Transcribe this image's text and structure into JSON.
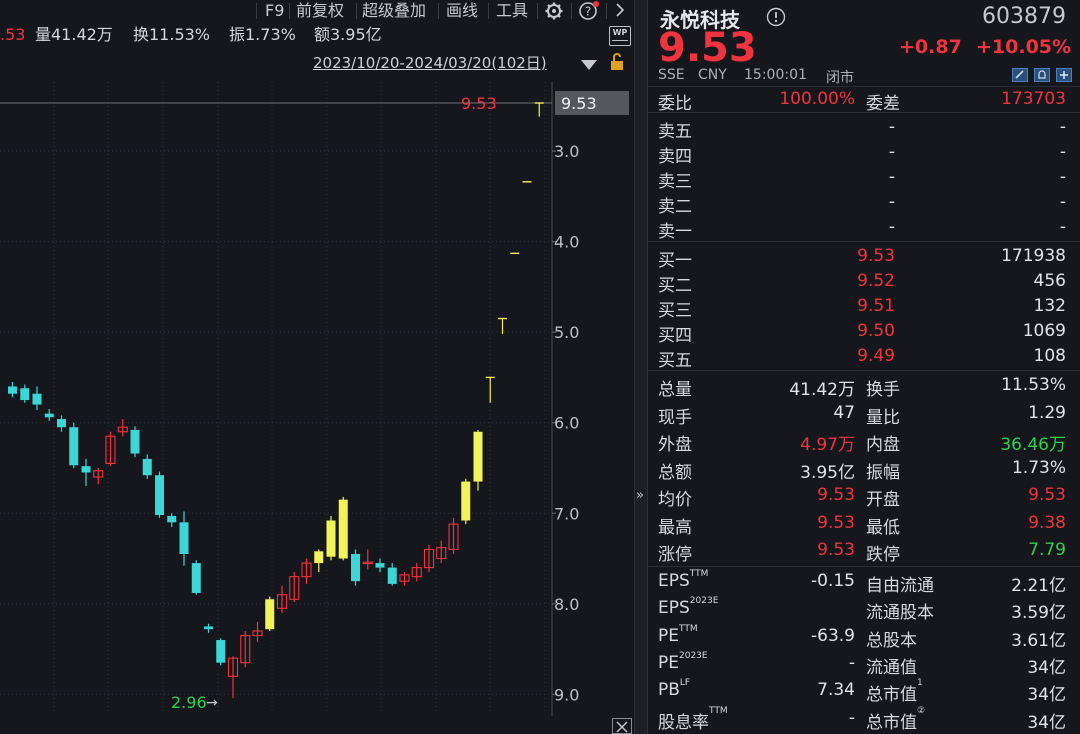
{
  "toolbar": {
    "f9": "F9",
    "adjust": "前复权",
    "overlay": "超级叠加",
    "draw": "画线",
    "tools": "工具"
  },
  "info": {
    "price_tail": ".53",
    "volume": "量41.42万",
    "turnover": "换11.53%",
    "amplitude": "振1.73%",
    "amount": "额3.95亿",
    "wp_badge": "WP",
    "date_range": "2023/10/20-2024/03/20(102日)"
  },
  "chart": {
    "current_label": "9.53",
    "current_tag": "9.53",
    "low_label": "2.96",
    "low_arrow": "→",
    "y_ticks": [
      "9.0",
      "8.0",
      "7.0",
      "6.0",
      "5.0",
      "4.0",
      "3.0"
    ]
  },
  "chart_data": {
    "type": "candlestick",
    "ylim": [
      2.85,
      9.6
    ],
    "y_ticks": [
      3.0,
      4.0,
      5.0,
      6.0,
      7.0,
      8.0,
      9.0
    ],
    "candles": [
      {
        "o": 6.4,
        "h": 6.45,
        "l": 6.28,
        "c": 6.32
      },
      {
        "o": 6.38,
        "h": 6.42,
        "l": 6.22,
        "c": 6.25
      },
      {
        "o": 6.32,
        "h": 6.4,
        "l": 6.14,
        "c": 6.2
      },
      {
        "o": 6.1,
        "h": 6.15,
        "l": 6.02,
        "c": 6.06
      },
      {
        "o": 6.04,
        "h": 6.08,
        "l": 5.9,
        "c": 5.95
      },
      {
        "o": 5.95,
        "h": 6.0,
        "l": 5.5,
        "c": 5.53
      },
      {
        "o": 5.52,
        "h": 5.6,
        "l": 5.3,
        "c": 5.45
      },
      {
        "o": 5.4,
        "h": 5.5,
        "l": 5.32,
        "c": 5.47
      },
      {
        "o": 5.55,
        "h": 5.9,
        "l": 5.52,
        "c": 5.85
      },
      {
        "o": 5.9,
        "h": 6.04,
        "l": 5.85,
        "c": 5.95
      },
      {
        "o": 5.92,
        "h": 5.96,
        "l": 5.62,
        "c": 5.66
      },
      {
        "o": 5.6,
        "h": 5.65,
        "l": 5.38,
        "c": 5.42
      },
      {
        "o": 5.42,
        "h": 5.46,
        "l": 4.95,
        "c": 4.98
      },
      {
        "o": 4.97,
        "h": 5.0,
        "l": 4.85,
        "c": 4.9
      },
      {
        "o": 4.9,
        "h": 5.02,
        "l": 4.42,
        "c": 4.55
      },
      {
        "o": 4.45,
        "h": 4.48,
        "l": 4.1,
        "c": 4.12
      },
      {
        "o": 3.75,
        "h": 3.78,
        "l": 3.68,
        "c": 3.72
      },
      {
        "o": 3.6,
        "h": 3.62,
        "l": 3.32,
        "c": 3.35
      },
      {
        "o": 3.2,
        "h": 3.42,
        "l": 2.96,
        "c": 3.4
      },
      {
        "o": 3.35,
        "h": 3.7,
        "l": 3.3,
        "c": 3.65
      },
      {
        "o": 3.65,
        "h": 3.8,
        "l": 3.58,
        "c": 3.7
      },
      {
        "o": 3.72,
        "h": 4.08,
        "l": 3.7,
        "c": 4.05
      },
      {
        "o": 3.95,
        "h": 4.2,
        "l": 3.9,
        "c": 4.1
      },
      {
        "o": 4.05,
        "h": 4.35,
        "l": 4.02,
        "c": 4.3
      },
      {
        "o": 4.3,
        "h": 4.5,
        "l": 4.22,
        "c": 4.45
      },
      {
        "o": 4.45,
        "h": 4.6,
        "l": 4.35,
        "c": 4.58
      },
      {
        "o": 4.52,
        "h": 4.97,
        "l": 4.48,
        "c": 4.92
      },
      {
        "o": 4.5,
        "h": 5.18,
        "l": 4.48,
        "c": 5.15
      },
      {
        "o": 4.55,
        "h": 4.6,
        "l": 4.2,
        "c": 4.25
      },
      {
        "o": 4.45,
        "h": 4.6,
        "l": 4.38,
        "c": 4.46
      },
      {
        "o": 4.45,
        "h": 4.5,
        "l": 4.35,
        "c": 4.4
      },
      {
        "o": 4.4,
        "h": 4.45,
        "l": 4.2,
        "c": 4.22
      },
      {
        "o": 4.25,
        "h": 4.35,
        "l": 4.2,
        "c": 4.32
      },
      {
        "o": 4.3,
        "h": 4.45,
        "l": 4.25,
        "c": 4.4
      },
      {
        "o": 4.4,
        "h": 4.65,
        "l": 4.35,
        "c": 4.6
      },
      {
        "o": 4.5,
        "h": 4.7,
        "l": 4.45,
        "c": 4.62
      },
      {
        "o": 4.6,
        "h": 4.95,
        "l": 4.55,
        "c": 4.88
      },
      {
        "o": 4.92,
        "h": 5.38,
        "l": 4.88,
        "c": 5.35
      },
      {
        "o": 5.35,
        "h": 5.92,
        "l": 5.25,
        "c": 5.9
      },
      {
        "o": 6.5,
        "h": 6.5,
        "l": 6.22,
        "c": 6.5
      },
      {
        "o": 7.15,
        "h": 7.15,
        "l": 6.98,
        "c": 7.15
      },
      {
        "o": 7.87,
        "h": 7.87,
        "l": 7.87,
        "c": 7.87
      },
      {
        "o": 8.66,
        "h": 8.66,
        "l": 8.66,
        "c": 8.66
      },
      {
        "o": 9.53,
        "h": 9.53,
        "l": 9.38,
        "c": 9.53
      }
    ]
  },
  "stock": {
    "name": "永悦科技",
    "code": "603879",
    "price": "9.53",
    "change": "+0.87",
    "pct": "+10.05%",
    "exchange": "SSE",
    "currency": "CNY",
    "time": "15:00:01",
    "status": "闭市"
  },
  "weibi": {
    "label1": "委比",
    "val1": "100.00%",
    "label2": "委差",
    "val2": "173703"
  },
  "asks": [
    {
      "label": "卖五",
      "price": "-",
      "vol": "-"
    },
    {
      "label": "卖四",
      "price": "-",
      "vol": "-"
    },
    {
      "label": "卖三",
      "price": "-",
      "vol": "-"
    },
    {
      "label": "卖二",
      "price": "-",
      "vol": "-"
    },
    {
      "label": "卖一",
      "price": "-",
      "vol": "-"
    }
  ],
  "bids": [
    {
      "label": "买一",
      "price": "9.53",
      "vol": "171938"
    },
    {
      "label": "买二",
      "price": "9.52",
      "vol": "456"
    },
    {
      "label": "买三",
      "price": "9.51",
      "vol": "132"
    },
    {
      "label": "买四",
      "price": "9.50",
      "vol": "1069"
    },
    {
      "label": "买五",
      "price": "9.49",
      "vol": "108"
    }
  ],
  "stats": [
    {
      "l1": "总量",
      "v1": "41.42万",
      "c1": "white",
      "l2": "换手",
      "v2": "11.53%",
      "c2": "white"
    },
    {
      "l1": "现手",
      "v1": "47",
      "c1": "white",
      "l2": "量比",
      "v2": "1.29",
      "c2": "white"
    },
    {
      "l1": "外盘",
      "v1": "4.97万",
      "c1": "red",
      "l2": "内盘",
      "v2": "36.46万",
      "c2": "green"
    },
    {
      "l1": "总额",
      "v1": "3.95亿",
      "c1": "white",
      "l2": "振幅",
      "v2": "1.73%",
      "c2": "white"
    },
    {
      "l1": "均价",
      "v1": "9.53",
      "c1": "red",
      "l2": "开盘",
      "v2": "9.53",
      "c2": "red"
    },
    {
      "l1": "最高",
      "v1": "9.53",
      "c1": "red",
      "l2": "最低",
      "v2": "9.38",
      "c2": "red"
    },
    {
      "l1": "涨停",
      "v1": "9.53",
      "c1": "red",
      "l2": "跌停",
      "v2": "7.79",
      "c2": "green"
    }
  ],
  "fundamentals": [
    {
      "l1": "EPS",
      "s1": "TTM",
      "v1": "-0.15",
      "l2": "自由流通",
      "v2": "2.21亿"
    },
    {
      "l1": "EPS",
      "s1": "2023E",
      "v1": "",
      "l2": "流通股本",
      "v2": "3.59亿"
    },
    {
      "l1": "PE",
      "s1": "TTM",
      "v1": "-63.9",
      "l2": "总股本",
      "v2": "3.61亿"
    },
    {
      "l1": "PE",
      "s1": "2023E",
      "v1": "-",
      "l2": "流通值",
      "v2": "34亿"
    },
    {
      "l1": "PB",
      "s1": "LF",
      "v1": "7.34",
      "l2": "总市值",
      "s2": "1",
      "v2": "34亿"
    },
    {
      "l1": "股息率",
      "s1": "TTM",
      "v1": "-",
      "l2": "总市值",
      "s2": "②",
      "v2": "34亿"
    }
  ],
  "colors": {
    "up": "#f0343f",
    "down": "#2fd050",
    "yellow": "#f2f25a",
    "cyan": "#3dd6d6",
    "bg": "#15171c"
  }
}
